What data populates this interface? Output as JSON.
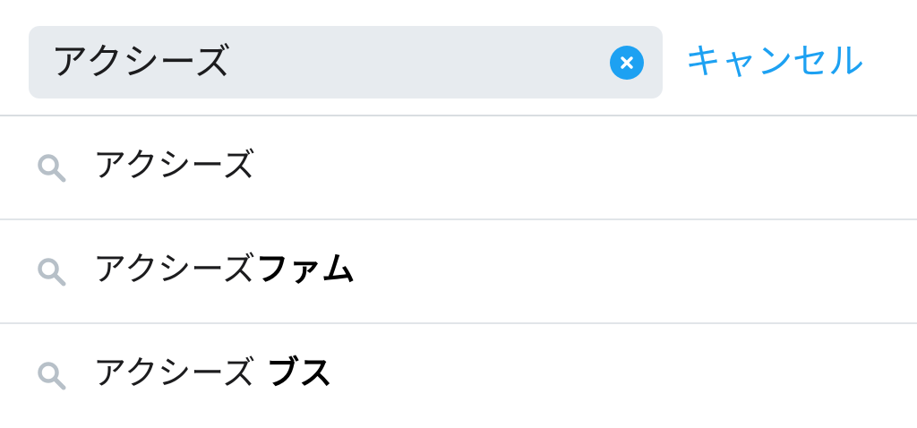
{
  "search": {
    "query": "アクシーズ",
    "cancel_label": "キャンセル",
    "accent_color": "#1da1f2"
  },
  "icons": {
    "clear": "clear-x-circle-icon",
    "suggestion": "search-icon"
  },
  "suggestions": [
    {
      "base": "アクシーズ",
      "bold": ""
    },
    {
      "base": "アクシーズ",
      "bold": "ファム"
    },
    {
      "base": "アクシーズ ",
      "bold": "ブス"
    }
  ]
}
